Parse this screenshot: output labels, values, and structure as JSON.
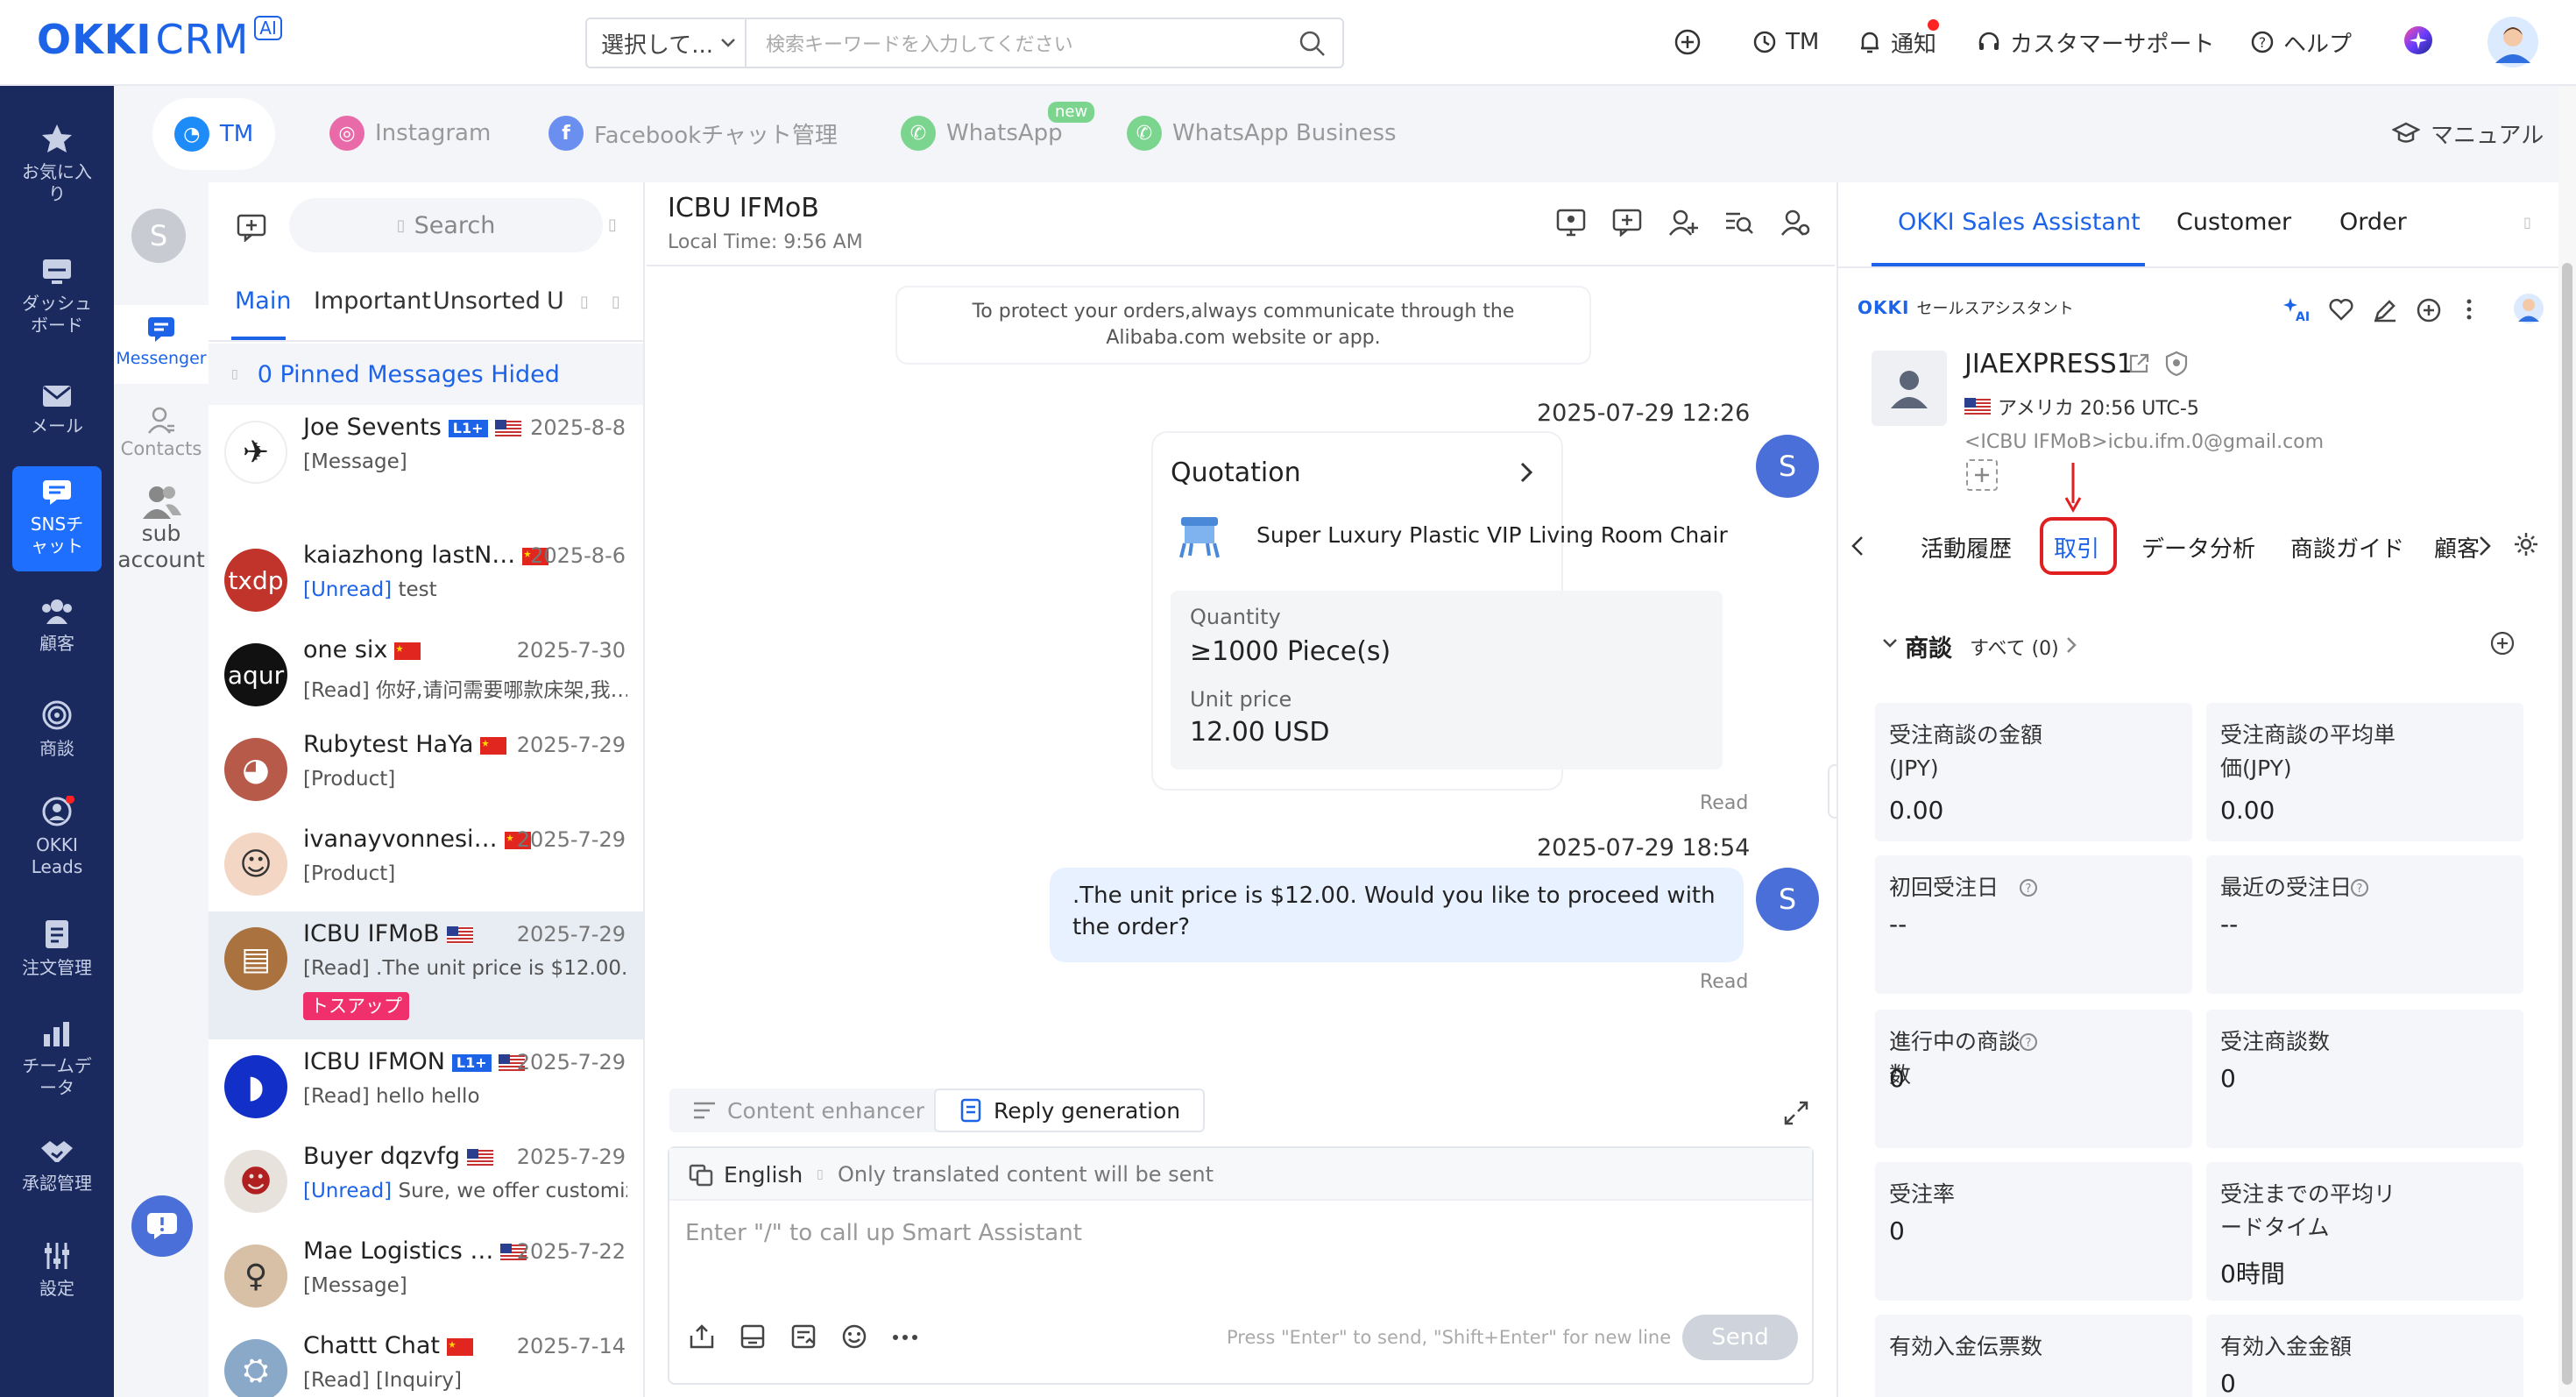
{
  "app": {
    "logo_a": "OKKI",
    "logo_b": "CRM",
    "logo_ai": "AI"
  },
  "top_search": {
    "select_label": "選択して...",
    "placeholder": "検索キーワードを入力してください"
  },
  "top_nav": {
    "tm": "TM",
    "notify": "通知",
    "support": "カスタマーサポート",
    "help": "ヘルプ"
  },
  "sidebar": {
    "items": [
      {
        "label": "お気に入り"
      },
      {
        "label": "ダッシュボード"
      },
      {
        "label": "メール"
      },
      {
        "label": "SNSチャット"
      },
      {
        "label": "顧客"
      },
      {
        "label": "商談"
      },
      {
        "label": "OKKI Leads"
      },
      {
        "label": "注文管理"
      },
      {
        "label": "チームデータ"
      },
      {
        "label": "承認管理"
      },
      {
        "label": "設定"
      }
    ]
  },
  "channels": {
    "tm": "TM",
    "instagram": "Instagram",
    "facebook": "Facebookチャット管理",
    "whatsapp": "WhatsApp",
    "whatsapp_new": "new",
    "whatsapp_business": "WhatsApp Business",
    "manual": "マニュアル"
  },
  "subside": {
    "avatar": "S",
    "messenger": "Messenger",
    "contacts": "Contacts",
    "sub_account": "sub account"
  },
  "convlist": {
    "search_placeholder": "Search",
    "tabs": [
      "Main",
      "Important",
      "Unsorted",
      "U"
    ],
    "pinned": "0 Pinned Messages Hided",
    "items": [
      {
        "name": "Joe Sevents",
        "date": "2025-8-8",
        "status": "",
        "preview": "[Message]",
        "l1": true,
        "flag": "us"
      },
      {
        "name": "kaiazhong lastN…",
        "date": "2025-8-6",
        "status": "[Unread]",
        "preview": "test",
        "l1": false,
        "flag": "cn"
      },
      {
        "name": "one six",
        "date": "2025-7-30",
        "status": "",
        "preview": "[Read] 你好,请问需要哪款床架,我…",
        "l1": false,
        "flag": "cn"
      },
      {
        "name": "Rubytest HaYa",
        "date": "2025-7-29",
        "status": "",
        "preview": "[Product]",
        "l1": false,
        "flag": "cn"
      },
      {
        "name": "ivanayvonnesi…",
        "date": "2025-7-29",
        "status": "",
        "preview": "[Product]",
        "l1": false,
        "flag": "cn"
      },
      {
        "name": "ICBU IFMoB",
        "date": "2025-7-29",
        "status": "",
        "preview": "[Read]  .The unit price is $12.00. …",
        "l1": false,
        "flag": "us",
        "tag": "トスアップ"
      },
      {
        "name": "ICBU IFMON",
        "date": "2025-7-29",
        "status": "",
        "preview": "[Read]  hello hello",
        "l1": true,
        "flag": "us"
      },
      {
        "name": "Buyer dqzvfg",
        "date": "2025-7-29",
        "status": "[Unread]",
        "preview": "Sure, we offer customiz…",
        "l1": false,
        "flag": "us"
      },
      {
        "name": "Mae Logistics …",
        "date": "2025-7-22",
        "status": "",
        "preview": "[Message]",
        "l1": false,
        "flag": "us"
      },
      {
        "name": "Chattt Chat",
        "date": "2025-7-14",
        "status": "",
        "preview": "[Read]  [Inquiry]",
        "l1": false,
        "flag": "cn"
      }
    ]
  },
  "chat": {
    "title": "ICBU IFMoB",
    "local_time": "Local Time: 9:56 AM",
    "notice": "To protect your orders,always communicate through the Alibaba.com website or app.",
    "msg1_time": "2025-07-29 12:26",
    "quotation_title": "Quotation",
    "product": "Super Luxury Plastic VIP Living Room Chair",
    "qty_label": "Quantity",
    "qty_value": "≥1000 Piece(s)",
    "price_label": "Unit price",
    "price_value": "12.00 USD",
    "read1": "Read",
    "msg2_time": "2025-07-29 18:54",
    "msg2_text": ".The unit price is $12.00. Would you like to proceed with the order?",
    "read2": "Read",
    "avatar": "S",
    "content_enhancer": "Content enhancer",
    "reply_generation": "Reply generation",
    "lang": "English",
    "translate_note": "Only translated content will be sent",
    "input_placeholder": "Enter \"/\" to call up Smart Assistant",
    "send_hint": "Press \"Enter\" to send, \"Shift+Enter\" for new line",
    "send": "Send"
  },
  "rpanel": {
    "tabs": [
      "OKKI Sales Assistant",
      "Customer",
      "Order"
    ],
    "assistant_label": "セールスアシスタント",
    "assistant_logo": "OKKI",
    "customer_name": "JIAEXPRESS1",
    "location": "アメリカ 20:56 UTC-5",
    "email": "<ICBU IFMoB>icbu.ifm.0@gmail.com",
    "subtabs": [
      "活動履歴",
      "取引",
      "データ分析",
      "商談ガイド",
      "顧客"
    ],
    "section_title": "商談",
    "section_all": "すべて (0)",
    "cards": [
      {
        "label": "受注商談の金額(JPY)",
        "value": "0.00",
        "help": false
      },
      {
        "label": "受注商談の平均単価(JPY)",
        "value": "0.00",
        "help": false
      },
      {
        "label": "初回受注日",
        "value": "--",
        "help": true
      },
      {
        "label": "最近の受注日",
        "value": "--",
        "help": true
      },
      {
        "label": "進行中の商談数",
        "value": "0",
        "help": true
      },
      {
        "label": "受注商談数",
        "value": "0",
        "help": false
      },
      {
        "label": "受注率",
        "value": "0",
        "help": false
      },
      {
        "label": "受注までの平均リードタイム",
        "value": "0時間",
        "help": false
      },
      {
        "label": "有効入金伝票数",
        "value": "",
        "help": false
      },
      {
        "label": "有効入金金額",
        "value": "0",
        "help": false
      }
    ]
  },
  "colors": {
    "brand": "#1d63e8",
    "sidebar": "#1a2a5e",
    "highlight_red": "#e02020",
    "tag_pink": "#f0306c"
  }
}
